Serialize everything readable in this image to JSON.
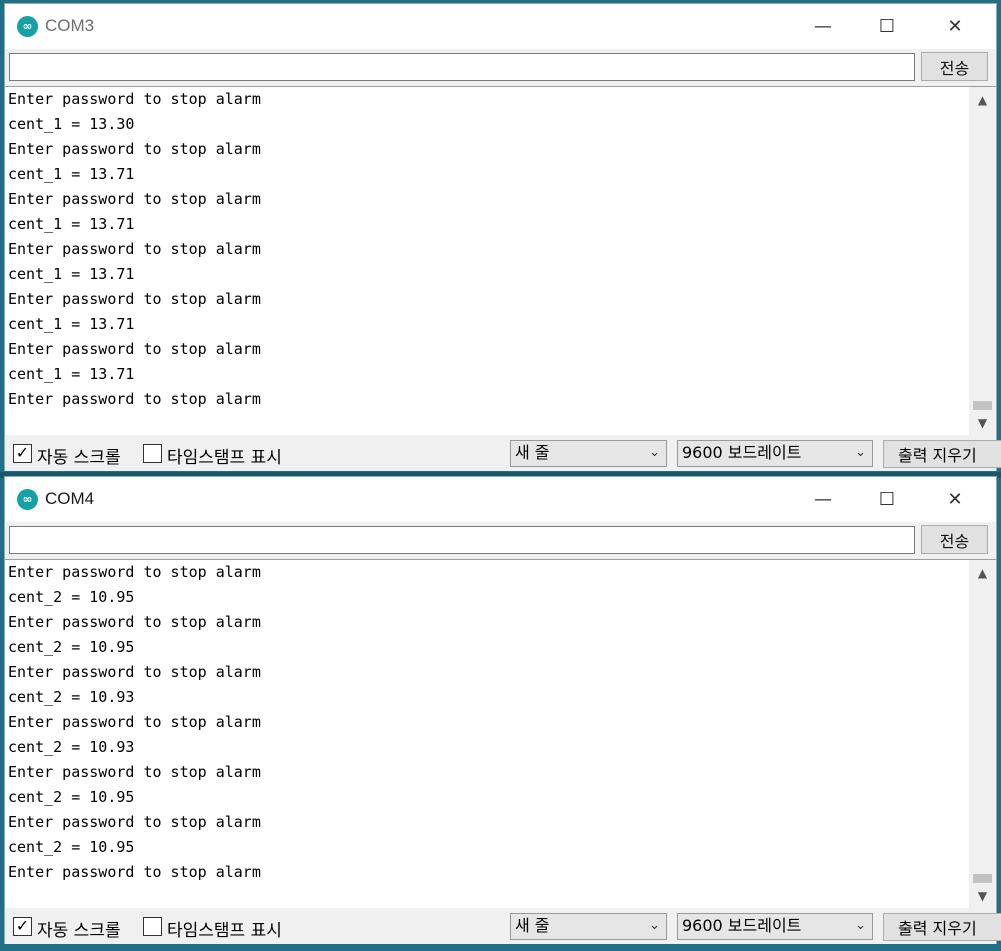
{
  "windows": [
    {
      "title": "COM3",
      "send_label": "전송",
      "send_value": "",
      "lines": [
        "Enter password to stop alarm",
        "cent_1 = 13.30",
        "Enter password to stop alarm",
        "cent_1 = 13.71",
        "Enter password to stop alarm",
        "cent_1 = 13.71",
        "Enter password to stop alarm",
        "cent_1 = 13.71",
        "Enter password to stop alarm",
        "cent_1 = 13.71",
        "Enter password to stop alarm",
        "cent_1 = 13.71",
        "Enter password to stop alarm"
      ],
      "autoscroll_label": "자동 스크롤",
      "autoscroll_checked": true,
      "timestamp_label": "타임스탬프 표시",
      "timestamp_checked": false,
      "line_ending": "새 줄",
      "baud": "9600 보드레이트",
      "clear_label": "출력 지우기"
    },
    {
      "title": "COM4",
      "send_label": "전송",
      "send_value": "",
      "lines": [
        "Enter password to stop alarm",
        "cent_2 = 10.95",
        "Enter password to stop alarm",
        "cent_2 = 10.95",
        "Enter password to stop alarm",
        "cent_2 = 10.93",
        "Enter password to stop alarm",
        "cent_2 = 10.93",
        "Enter password to stop alarm",
        "cent_2 = 10.95",
        "Enter password to stop alarm",
        "cent_2 = 10.95",
        "Enter password to stop alarm"
      ],
      "autoscroll_label": "자동 스크롤",
      "autoscroll_checked": true,
      "timestamp_label": "타임스탬프 표시",
      "timestamp_checked": false,
      "line_ending": "새 줄",
      "baud": "9600 보드레이트",
      "clear_label": "출력 지우기"
    }
  ],
  "icons": {
    "app": "arduino-icon",
    "minimize": "minimize-icon",
    "maximize": "maximize-icon",
    "close": "close-icon",
    "checkbox": "checkmark-icon",
    "dropdown": "chevron-down-icon",
    "scroll_up": "chevron-up-icon",
    "scroll_down": "chevron-down-icon"
  },
  "colors": {
    "desktop": "#1f6f86",
    "app_icon": "#17a1a5",
    "window_bg": "#f0f0f0",
    "console_bg": "#ffffff"
  }
}
